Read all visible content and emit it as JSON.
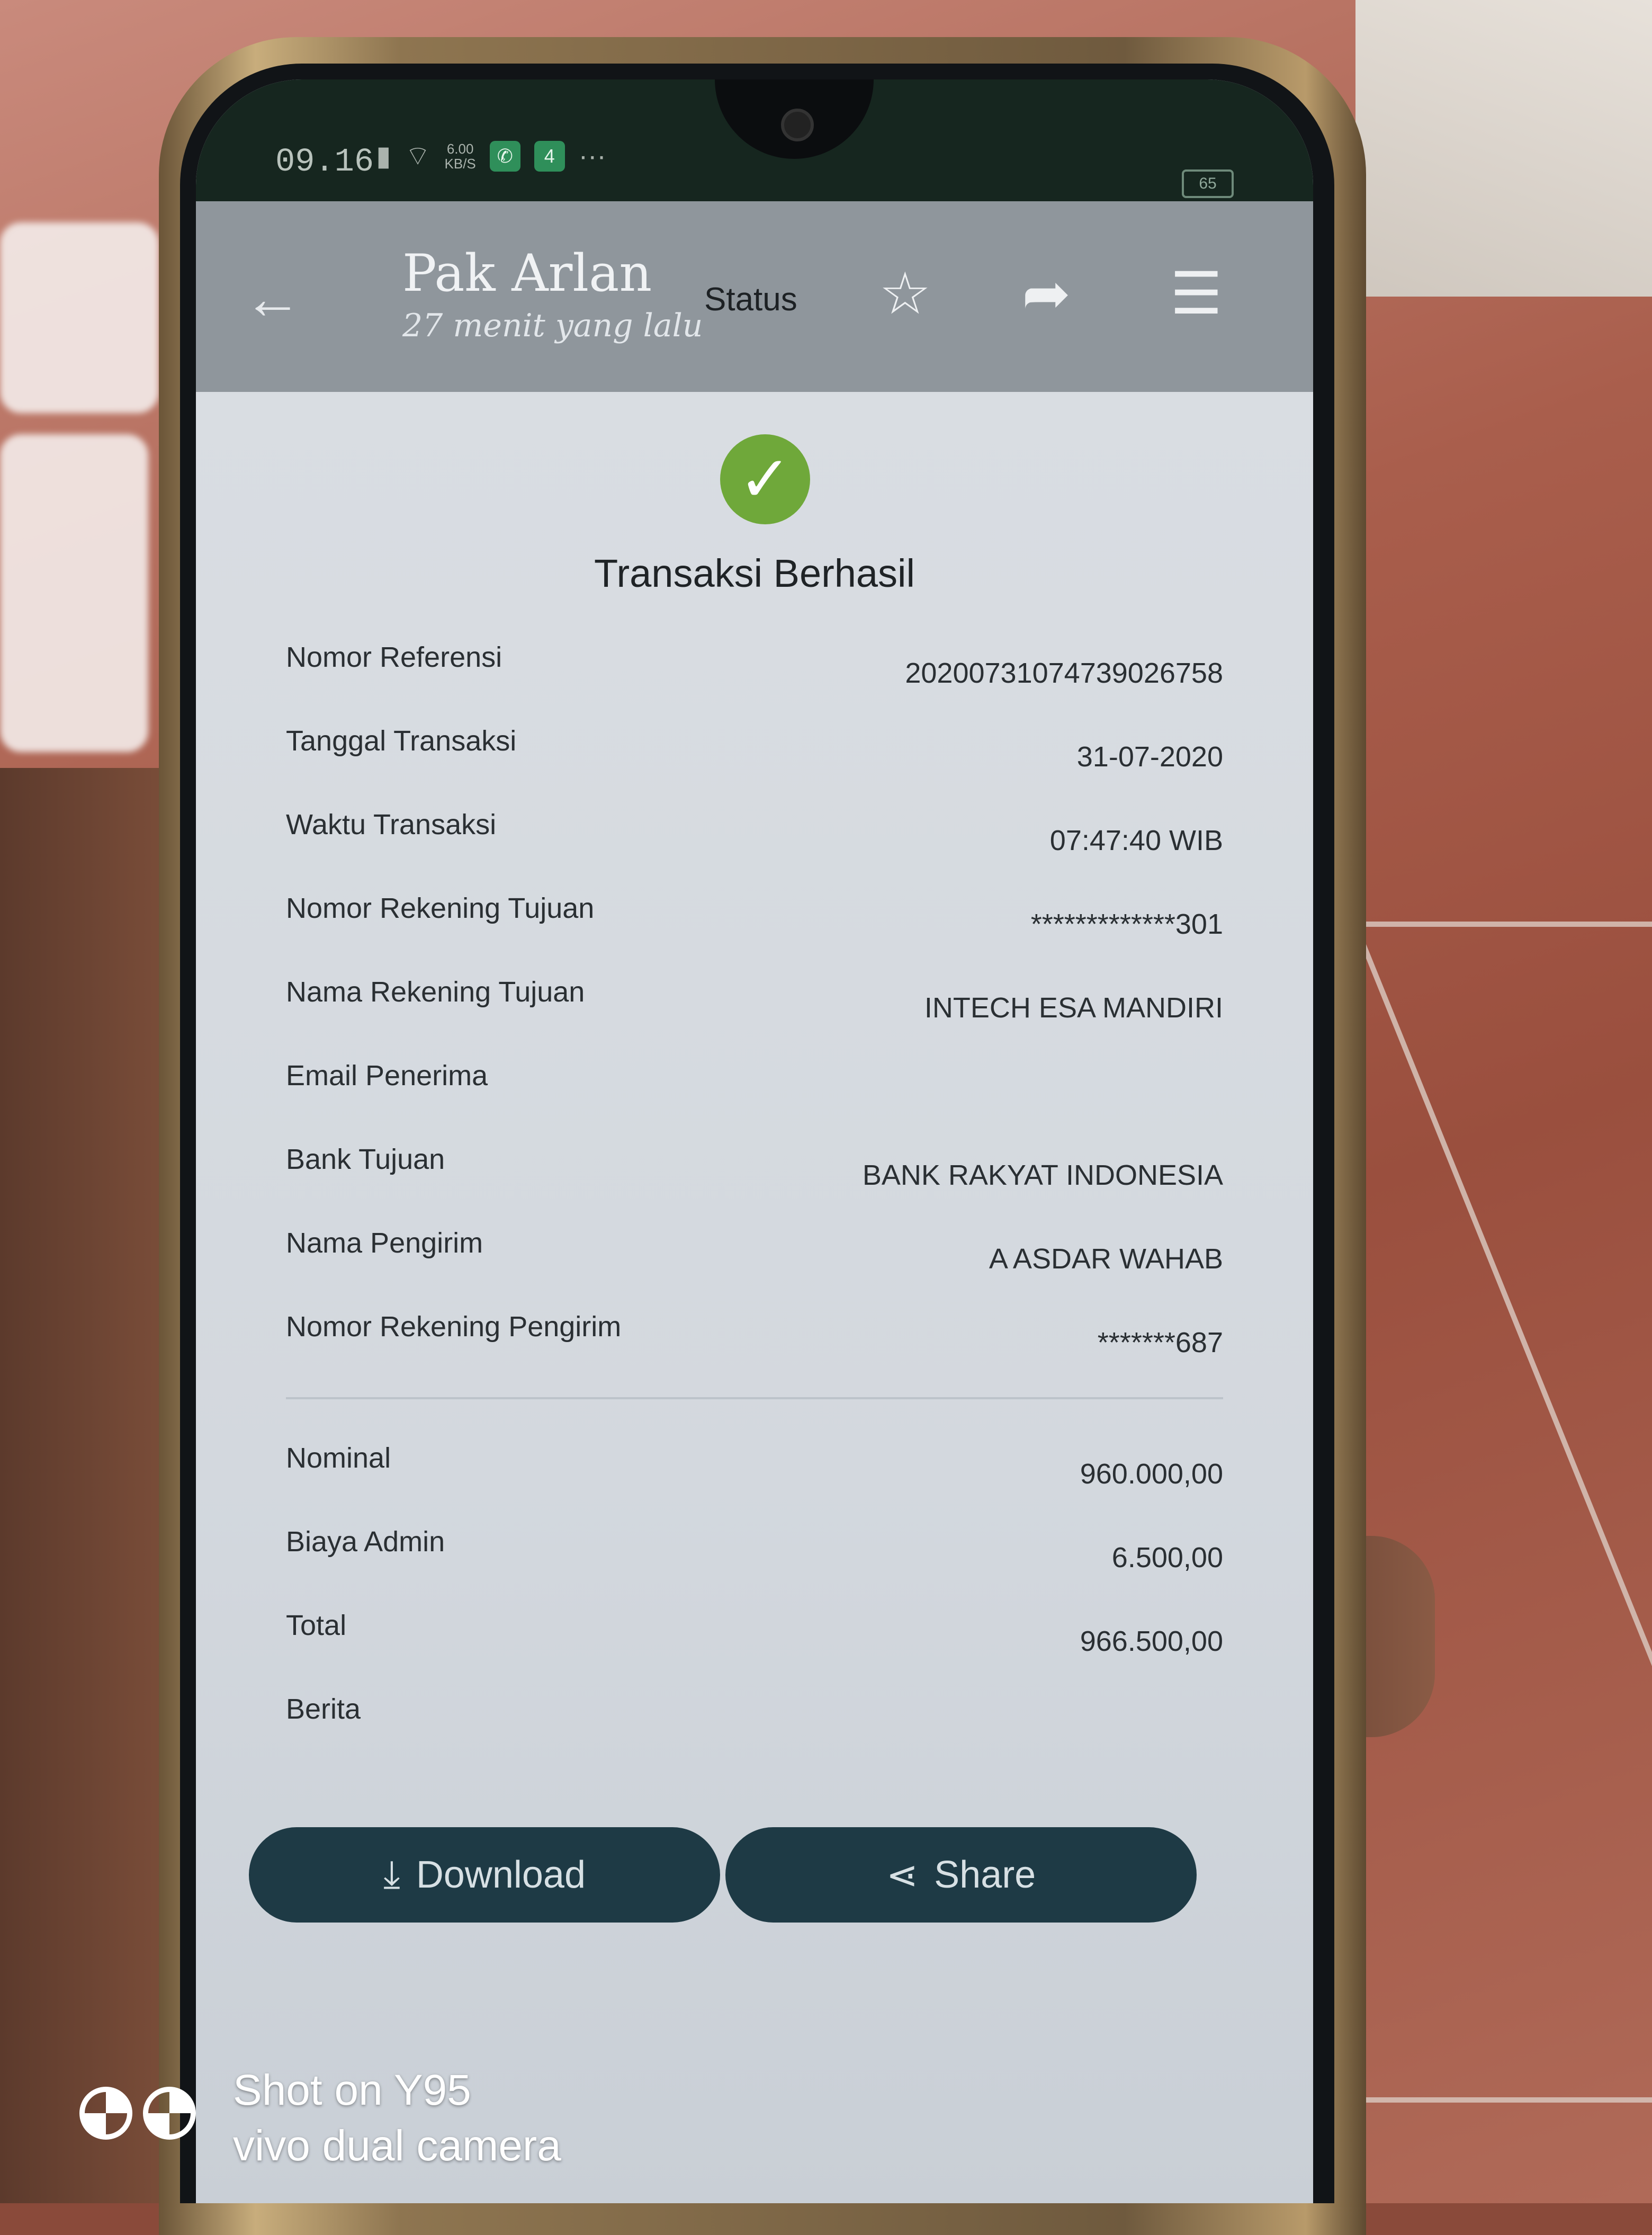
{
  "status_bar": {
    "time": "09.16",
    "signal_icon": "signal-icon",
    "wifi_icon": "wifi-icon",
    "speed_value": "6.00",
    "speed_unit": "KB/S",
    "whatsapp_icon": "whatsapp-icon",
    "notif_badge": "4",
    "more": "···",
    "battery": "65"
  },
  "header": {
    "back_icon": "arrow-left-icon",
    "contact_name": "Pak Arlan",
    "contact_time": "27 menit yang lalu",
    "status_label": "Status",
    "star_icon": "star-icon",
    "forward_icon": "forward-icon",
    "menu_icon": "menu-icon"
  },
  "receipt": {
    "title": "Transaksi Berhasil",
    "rows": [
      {
        "label": "Nomor Referensi",
        "value": "20200731074739026758"
      },
      {
        "label": "Tanggal Transaksi",
        "value": "31-07-2020"
      },
      {
        "label": "Waktu Transaksi",
        "value": "07:47:40 WIB"
      },
      {
        "label": "Nomor Rekening Tujuan",
        "value": "*************301"
      },
      {
        "label": "Nama Rekening Tujuan",
        "value": "INTECH ESA MANDIRI"
      },
      {
        "label": "Email Penerima",
        "value": ""
      },
      {
        "label": "Bank Tujuan",
        "value": "BANK RAKYAT INDONESIA"
      },
      {
        "label": "Nama Pengirim",
        "value": "A ASDAR WAHAB"
      },
      {
        "label": "Nomor Rekening Pengirim",
        "value": "*******687"
      }
    ],
    "amounts": [
      {
        "label": "Nominal",
        "value": "960.000,00"
      },
      {
        "label": "Biaya Admin",
        "value": "6.500,00"
      },
      {
        "label": "Total",
        "value": "966.500,00"
      },
      {
        "label": "Berita",
        "value": ""
      }
    ]
  },
  "actions": {
    "download_label": "Download",
    "share_label": "Share"
  },
  "watermark": {
    "line1": "Shot on Y95",
    "line2": "vivo dual camera"
  },
  "colors": {
    "success_green": "#6fa83a",
    "button_dark": "#1e3a45",
    "header_gray": "#8f969c"
  }
}
